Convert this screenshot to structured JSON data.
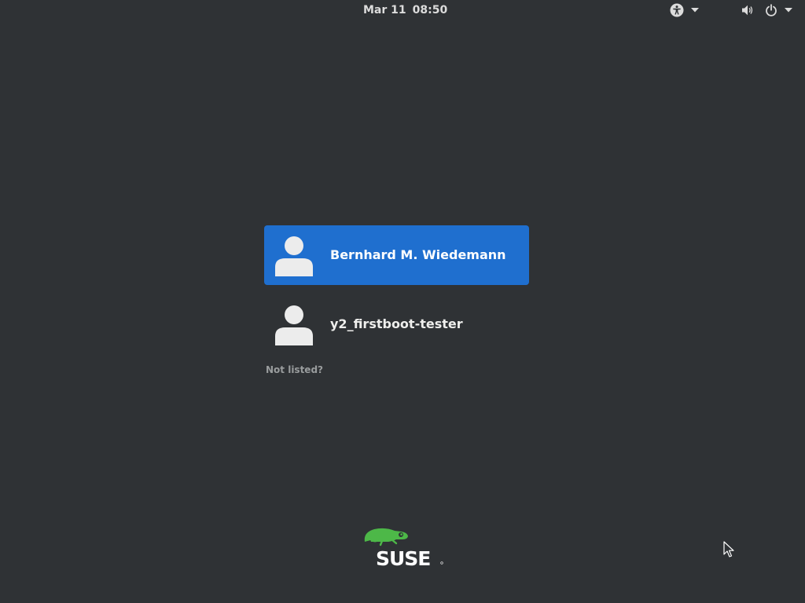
{
  "topbar": {
    "date": "Mar 11",
    "time": "08:50",
    "accessibility_icon": "accessibility-icon",
    "volume_icon": "volume-icon",
    "power_icon": "power-icon",
    "dropdown_icon": "chevron-down-icon"
  },
  "users": [
    {
      "name": "Bernhard M. Wiedemann",
      "selected": true,
      "avatar_icon": "user-avatar-icon"
    },
    {
      "name": "y2_firstboot-tester",
      "selected": false,
      "avatar_icon": "user-avatar-icon"
    }
  ],
  "not_listed_label": "Not listed?",
  "logo": {
    "brand": "SUSE",
    "brand_color": "#4db848"
  },
  "colors": {
    "background": "#2f3235",
    "selected_row": "#1f6fcf",
    "text": "#eeeeec",
    "muted_text": "#9a9d9e"
  }
}
